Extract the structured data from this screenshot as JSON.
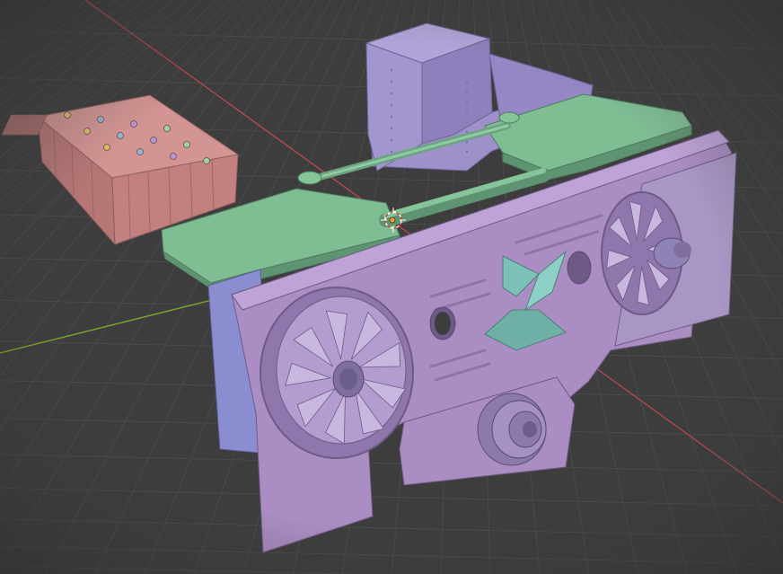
{
  "viewport": {
    "background_color": "#3d3d3d",
    "grid_color": "#4b4b4b",
    "x_axis_color": "#b5484f",
    "y_axis_color": "#7ea42a",
    "object_colors": {
      "battery_pink": "#c88684",
      "engine_purple": "#9b86c6",
      "frame_green": "#78b48c",
      "teal_bracket": "#7cc0b6",
      "radiator_blue": "#8b8fd0"
    }
  },
  "scene_objects": [
    {
      "name": "battery-box-pink"
    },
    {
      "name": "engine-block-lavender"
    },
    {
      "name": "chassis-frame-green"
    },
    {
      "name": "front-panel-purple"
    },
    {
      "name": "fan-assembly-left"
    },
    {
      "name": "fan-assembly-right"
    },
    {
      "name": "pulley-center"
    },
    {
      "name": "bracket-teal"
    }
  ],
  "origin_gizmo": {
    "icon": "3d-cursor-icon"
  }
}
